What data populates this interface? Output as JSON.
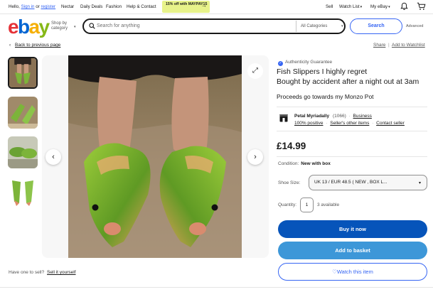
{
  "topbar": {
    "hi": "Hello,",
    "sign_in": "Sign in",
    "or": "or",
    "register": "register",
    "links": [
      "Nectar",
      "Daily Deals",
      "Fashion",
      "Help & Contact"
    ],
    "promo": "15% off with MAYPAY15",
    "sell": "Sell",
    "watch_list": "Watch List",
    "my_ebay": "My eBay"
  },
  "header": {
    "logo": [
      "e",
      "b",
      "a",
      "y"
    ],
    "shop_by_line1": "Shop by",
    "shop_by_line2": "category",
    "search_placeholder": "Search for anything",
    "category": "All Categories",
    "search_button": "Search",
    "advanced": "Advanced"
  },
  "nav": {
    "back": "Back to previous page",
    "share": "Share",
    "separator": "|",
    "add_to_watchlist": "Add to Watchlist"
  },
  "listing": {
    "authenticity": "Authenticity Guarantee",
    "title_line1": "Fish Slippers I highly regret",
    "title_line2": "Bought by accident after a night out at 3am",
    "subtitle": "Proceeds go towards my Monzo Pot",
    "seller_name": "Petal Myriadally",
    "seller_count": "(1066)",
    "seller_type": "Business",
    "positive": "100% positive",
    "other_items": "Seller's other items",
    "contact": "Contact seller",
    "price": "£14.99",
    "condition_label": "Condition:",
    "condition_value": "New with box",
    "size_label": "Shoe Size:",
    "size_value": "UK 13 / EUR 48.5 ( NEW , BOX L...",
    "qty_label": "Quantity:",
    "qty_value": "1",
    "available": "3 available",
    "buy_now": "Buy it now",
    "add_to_basket": "Add to basket",
    "watch_item": "♡Watch this item"
  },
  "footer": {
    "sell_prompt": "Have one to sell?",
    "sell_link": "Sell it yourself"
  },
  "icons": {
    "prev": "‹",
    "next": "›",
    "expand": "⤢",
    "back": "‹"
  },
  "colors": {
    "accent": "#3665f3",
    "buy": "#0654ba",
    "basket": "#3d97d8",
    "promo": "#e7f28a"
  }
}
